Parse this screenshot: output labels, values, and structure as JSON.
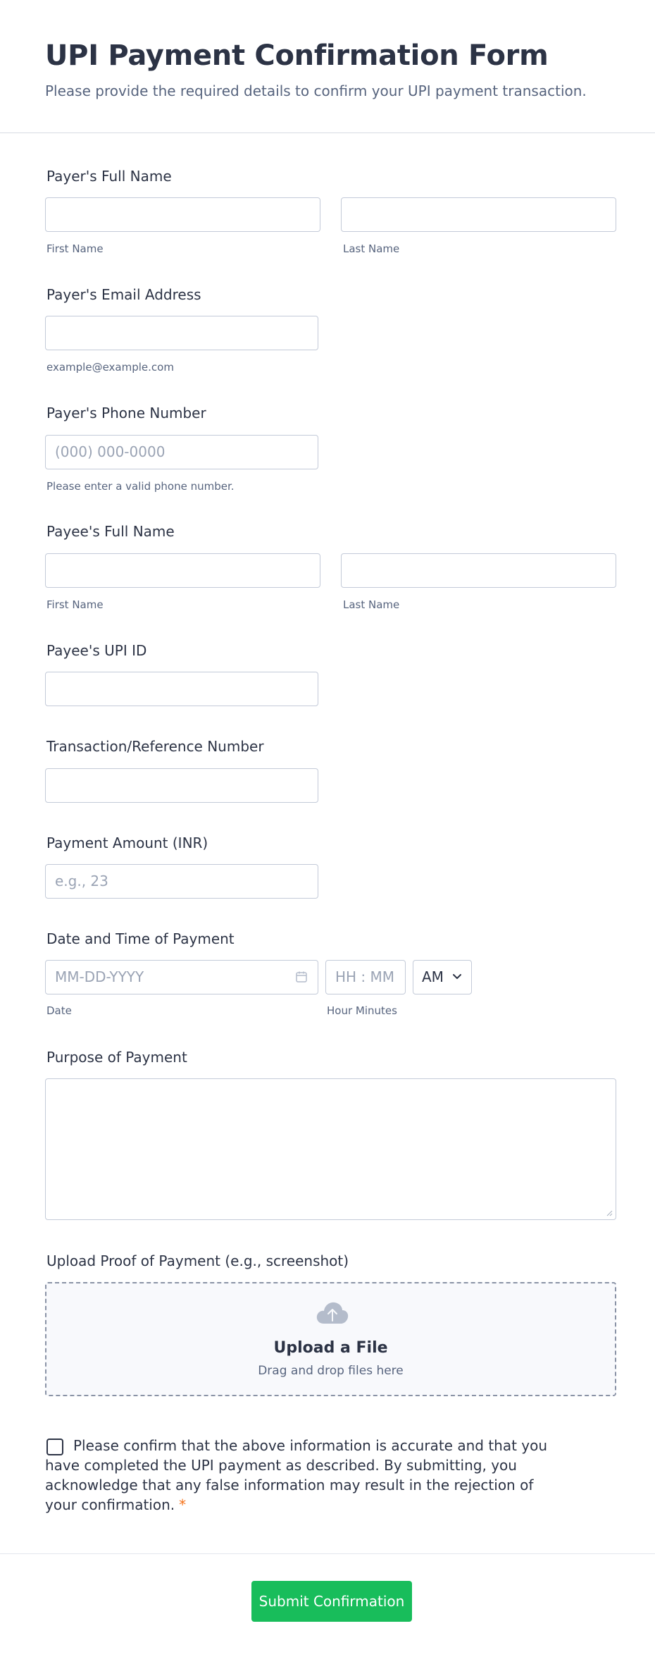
{
  "header": {
    "title": "UPI Payment Confirmation Form",
    "subtitle": "Please provide the required details to confirm your UPI payment transaction."
  },
  "fields": {
    "payer_name": {
      "label": "Payer's Full Name",
      "first_sublabel": "First Name",
      "last_sublabel": "Last Name",
      "first_value": "",
      "last_value": ""
    },
    "payer_email": {
      "label": "Payer's Email Address",
      "value": "",
      "sublabel": "example@example.com"
    },
    "payer_phone": {
      "label": "Payer's Phone Number",
      "placeholder": "(000) 000-0000",
      "sublabel": "Please enter a valid phone number."
    },
    "payee_name": {
      "label": "Payee's Full Name",
      "first_sublabel": "First Name",
      "last_sublabel": "Last Name",
      "first_value": "",
      "last_value": ""
    },
    "payee_upi": {
      "label": "Payee's UPI ID",
      "value": ""
    },
    "transaction_ref": {
      "label": "Transaction/Reference Number",
      "value": ""
    },
    "amount": {
      "label": "Payment Amount (INR)",
      "placeholder": "e.g., 23"
    },
    "datetime": {
      "label": "Date and Time of Payment",
      "date_placeholder": "MM-DD-YYYY",
      "time_placeholder": "HH : MM",
      "ampm_value": "AM",
      "date_sublabel": "Date",
      "time_sublabel": "Hour Minutes"
    },
    "purpose": {
      "label": "Purpose of Payment",
      "value": ""
    },
    "upload": {
      "label": "Upload Proof of Payment (e.g., screenshot)",
      "title": "Upload a File",
      "subtitle": "Drag and drop files here"
    },
    "consent": {
      "text": "Please confirm that the above information is accurate and that you have completed the UPI payment as described. By submitting, you acknowledge that any false information may result in the rejection of your confirmation.",
      "required_mark": "*",
      "checked": false
    }
  },
  "submit": {
    "label": "Submit Confirmation"
  },
  "colors": {
    "accent_green": "#18bd5b",
    "required_orange": "#f5721a",
    "text_dark": "#2c3345",
    "text_muted": "#57647e",
    "border": "#c3cad8"
  }
}
